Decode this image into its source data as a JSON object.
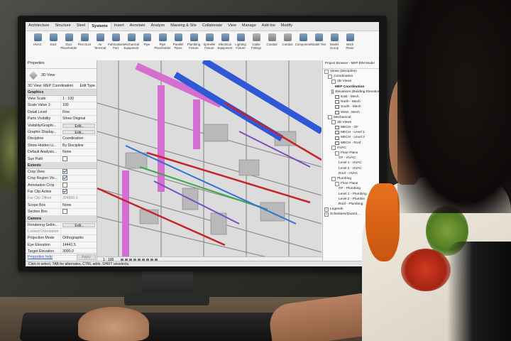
{
  "ribbon": {
    "tabs": [
      "Architecture",
      "Structure",
      "Steel",
      "Systems",
      "Insert",
      "Annotate",
      "Analyze",
      "Massing & Site",
      "Collaborate",
      "View",
      "Manage",
      "Add-Ins",
      "Modify"
    ],
    "active_tab": "Systems",
    "tools": [
      {
        "label": "HVAC",
        "icon": "hvac-icon"
      },
      {
        "label": "Duct",
        "icon": "duct-icon"
      },
      {
        "label": "Duct Placeholder",
        "icon": "duct-placeholder-icon"
      },
      {
        "label": "Flex Duct",
        "icon": "flex-duct-icon"
      },
      {
        "label": "Air Terminal",
        "icon": "air-terminal-icon"
      },
      {
        "label": "Fabrication Part",
        "icon": "fabrication-part-icon"
      },
      {
        "label": "Mechanical Equipment",
        "icon": "mechanical-equipment-icon"
      },
      {
        "label": "Pipe",
        "icon": "pipe-icon"
      },
      {
        "label": "Pipe Placeholder",
        "icon": "pipe-placeholder-icon"
      },
      {
        "label": "Parallel Pipes",
        "icon": "parallel-pipes-icon"
      },
      {
        "label": "Plumbing Fixture",
        "icon": "plumbing-fixture-icon"
      },
      {
        "label": "Sprinkler Fixture",
        "icon": "sprinkler-icon"
      },
      {
        "label": "Electrical Equipment",
        "icon": "electrical-equipment-icon"
      },
      {
        "label": "Lighting Fixture",
        "icon": "lighting-fixture-icon"
      },
      {
        "label": "Cable Fittings",
        "icon": "cable-fittings-icon"
      },
      {
        "label": "Conduit",
        "icon": "conduit-icon"
      },
      {
        "label": "Conduit",
        "icon": "conduit-fitting-icon"
      },
      {
        "label": "Component",
        "icon": "component-icon"
      },
      {
        "label": "Model Text",
        "icon": "model-text-icon"
      },
      {
        "label": "Model Group",
        "icon": "model-group-icon"
      },
      {
        "label": "Work Plane",
        "icon": "work-plane-icon"
      }
    ]
  },
  "properties": {
    "title": "Properties",
    "type_name": "3D View",
    "selector": "3D View: MEP Coordination",
    "edit_type": "Edit Type",
    "groups": [
      {
        "name": "Graphics",
        "rows": [
          {
            "k": "View Scale",
            "v": "1 : 100"
          },
          {
            "k": "Scale Value 1:",
            "v": "100"
          },
          {
            "k": "Detail Level",
            "v": "Fine"
          },
          {
            "k": "Parts Visibility",
            "v": "Show Original"
          },
          {
            "k": "Visibility/Graphi...",
            "v": "Edit...",
            "btn": true
          },
          {
            "k": "Graphic Display...",
            "v": "Edit...",
            "btn": true
          },
          {
            "k": "Discipline",
            "v": "Coordination"
          },
          {
            "k": "Show Hidden Li...",
            "v": "By Discipline"
          },
          {
            "k": "Default Analysis...",
            "v": "None"
          },
          {
            "k": "Sun Path",
            "v": "",
            "cb": false
          }
        ]
      },
      {
        "name": "Extents",
        "rows": [
          {
            "k": "Crop View",
            "v": "",
            "cb": true
          },
          {
            "k": "Crop Region Vis...",
            "v": "",
            "cb": true
          },
          {
            "k": "Annotation Crop",
            "v": "",
            "cb": false
          },
          {
            "k": "Far Clip Active",
            "v": "",
            "cb": true
          },
          {
            "k": "Far Clip Offset",
            "v": "304800.0",
            "dim": true
          },
          {
            "k": "Scope Box",
            "v": "None"
          },
          {
            "k": "Section Box",
            "v": "",
            "cb": false
          }
        ]
      },
      {
        "name": "Camera",
        "rows": [
          {
            "k": "Rendering Settin...",
            "v": "Edit...",
            "btn": true
          },
          {
            "k": "Locked Orientation",
            "v": "",
            "dim": true
          },
          {
            "k": "Projection Mode",
            "v": "Orthographic"
          },
          {
            "k": "Eye Elevation",
            "v": "14441.5"
          },
          {
            "k": "Target Elevation",
            "v": "3000.0"
          }
        ]
      }
    ],
    "help_link": "Properties help",
    "apply": "Apply"
  },
  "view": {
    "scale": "1 : 100"
  },
  "browser": {
    "title": "Project Browser - MEP BIM Model",
    "nodes": [
      {
        "label": "Views (Discipline)",
        "depth": 0,
        "tog": "-"
      },
      {
        "label": "Coordination",
        "depth": 1,
        "tog": "-"
      },
      {
        "label": "3D Views",
        "depth": 2,
        "tog": "-"
      },
      {
        "label": "MEP Coordination",
        "depth": 3,
        "bold": true
      },
      {
        "label": "Elevations (Building Elevation)",
        "depth": 2,
        "tog": "-"
      },
      {
        "label": "East - Mech",
        "depth": 3,
        "sq": true
      },
      {
        "label": "North - Mech",
        "depth": 3,
        "sq": true
      },
      {
        "label": "South - Mech",
        "depth": 3,
        "sq": true
      },
      {
        "label": "West - Mech",
        "depth": 3,
        "sq": true
      },
      {
        "label": "Mechanical",
        "depth": 1,
        "tog": "-"
      },
      {
        "label": "3D Views",
        "depth": 2,
        "tog": "-"
      },
      {
        "label": "MECH - GF",
        "depth": 3,
        "sq": true
      },
      {
        "label": "MECH - Level 1",
        "depth": 3,
        "sq": true
      },
      {
        "label": "MECH - Level 2",
        "depth": 3,
        "sq": true
      },
      {
        "label": "MECH - Roof",
        "depth": 3,
        "sq": true
      },
      {
        "label": "HVAC",
        "depth": 2,
        "tog": "-"
      },
      {
        "label": "Floor Plans",
        "depth": 3,
        "tog": "-"
      },
      {
        "label": "GF - HVAC",
        "depth": 4
      },
      {
        "label": "Level 1 - HVAC",
        "depth": 4
      },
      {
        "label": "Level 2 - HVAC",
        "depth": 4
      },
      {
        "label": "Roof - HVAC",
        "depth": 4
      },
      {
        "label": "Plumbing",
        "depth": 2,
        "tog": "-"
      },
      {
        "label": "Floor Plans",
        "depth": 3,
        "tog": "-"
      },
      {
        "label": "GF - Plumbing",
        "depth": 4
      },
      {
        "label": "Level 1 - Plumbing",
        "depth": 4
      },
      {
        "label": "Level 2 - Plumbin",
        "depth": 4
      },
      {
        "label": "Roof - Plumbing",
        "depth": 4
      },
      {
        "label": "Legends",
        "depth": 0,
        "tog": "+"
      },
      {
        "label": "Schedules/Quanti...",
        "depth": 0,
        "tog": "+"
      }
    ]
  },
  "statusbar": "Click to select, TAB for alternates, CTRL adds, SHIFT unselects."
}
